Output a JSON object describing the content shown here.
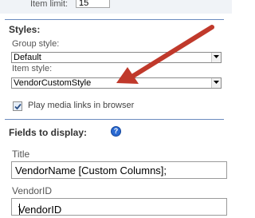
{
  "item_limit": {
    "label": "Item limit:",
    "value": "15"
  },
  "styles": {
    "header": "Styles:",
    "group_style": {
      "label": "Group style:",
      "value": "Default"
    },
    "item_style": {
      "label": "Item style:",
      "value": "VendorCustomStyle"
    },
    "play_media": {
      "label": "Play media links in browser",
      "checked": true
    }
  },
  "fields": {
    "header": "Fields to display:",
    "help_icon": "help-icon",
    "title": {
      "label": "Title",
      "value": "VendorName [Custom Columns];"
    },
    "vendor_id": {
      "label": "VendorID",
      "value": "VendorID"
    }
  },
  "annotation": {
    "arrow_color": "#c0392b"
  }
}
